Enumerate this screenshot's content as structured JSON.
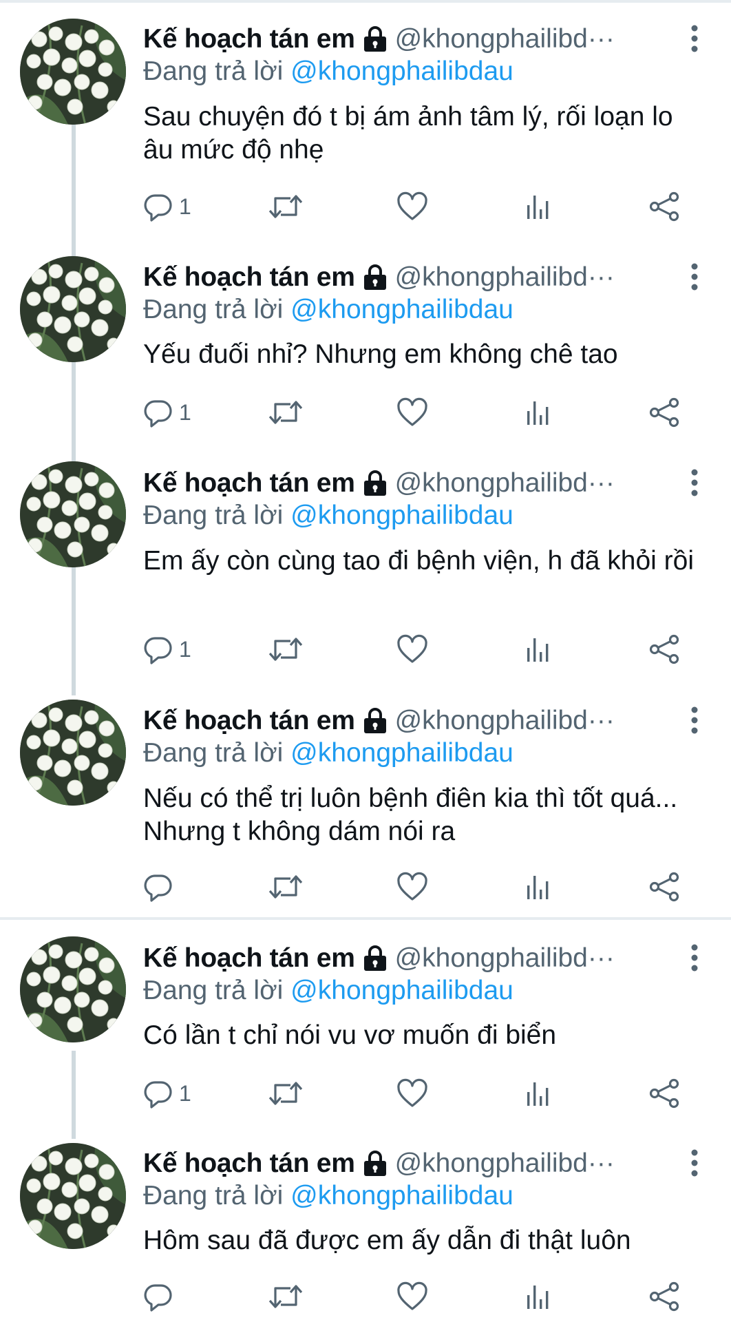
{
  "tweets": [
    {
      "display_name": "Kế hoạch tán em",
      "handle": "@khongphailibd···",
      "reply_prefix": "Đang trả lời",
      "reply_to": "@khongphailibdau",
      "text": "Sau chuyện đó t bị ám ảnh tâm lý, rối loạn lo âu mức độ nhẹ",
      "reply_count": "1"
    },
    {
      "display_name": "Kế hoạch tán em",
      "handle": "@khongphailibd···",
      "reply_prefix": "Đang trả lời",
      "reply_to": "@khongphailibdau",
      "text": "Yếu đuối nhỉ? Nhưng em không chê tao",
      "reply_count": "1"
    },
    {
      "display_name": "Kế hoạch tán em",
      "handle": "@khongphailibd···",
      "reply_prefix": "Đang trả lời",
      "reply_to": "@khongphailibdau",
      "text": "Em ấy còn cùng tao đi bệnh viện, h đã khỏi rồi",
      "reply_count": "1"
    },
    {
      "display_name": "Kế hoạch tán em",
      "handle": "@khongphailibd···",
      "reply_prefix": "Đang trả lời",
      "reply_to": "@khongphailibdau",
      "text": "Nếu có thể trị luôn bệnh điên kia thì tốt quá... Nhưng t không dám nói ra",
      "reply_count": ""
    },
    {
      "display_name": "Kế hoạch tán em",
      "handle": "@khongphailibd···",
      "reply_prefix": "Đang trả lời",
      "reply_to": "@khongphailibdau",
      "text": "Có lần t chỉ nói vu vơ muốn đi biển",
      "reply_count": "1"
    },
    {
      "display_name": "Kế hoạch tán em",
      "handle": "@khongphailibd···",
      "reply_prefix": "Đang trả lời",
      "reply_to": "@khongphailibdau",
      "text": "Hôm sau đã được em ấy dẫn đi thật luôn",
      "reply_count": ""
    }
  ],
  "icons": {
    "lock": "lock-icon",
    "more": "more-vertical-icon",
    "reply": "reply-icon",
    "retweet": "retweet-icon",
    "like": "heart-icon",
    "analytics": "analytics-icon",
    "share": "share-icon"
  },
  "colors": {
    "text_primary": "#0f1419",
    "text_secondary": "#536471",
    "mention": "#1d9bf0",
    "thread_line": "#cfd9de",
    "divider": "#e6ecf0"
  }
}
